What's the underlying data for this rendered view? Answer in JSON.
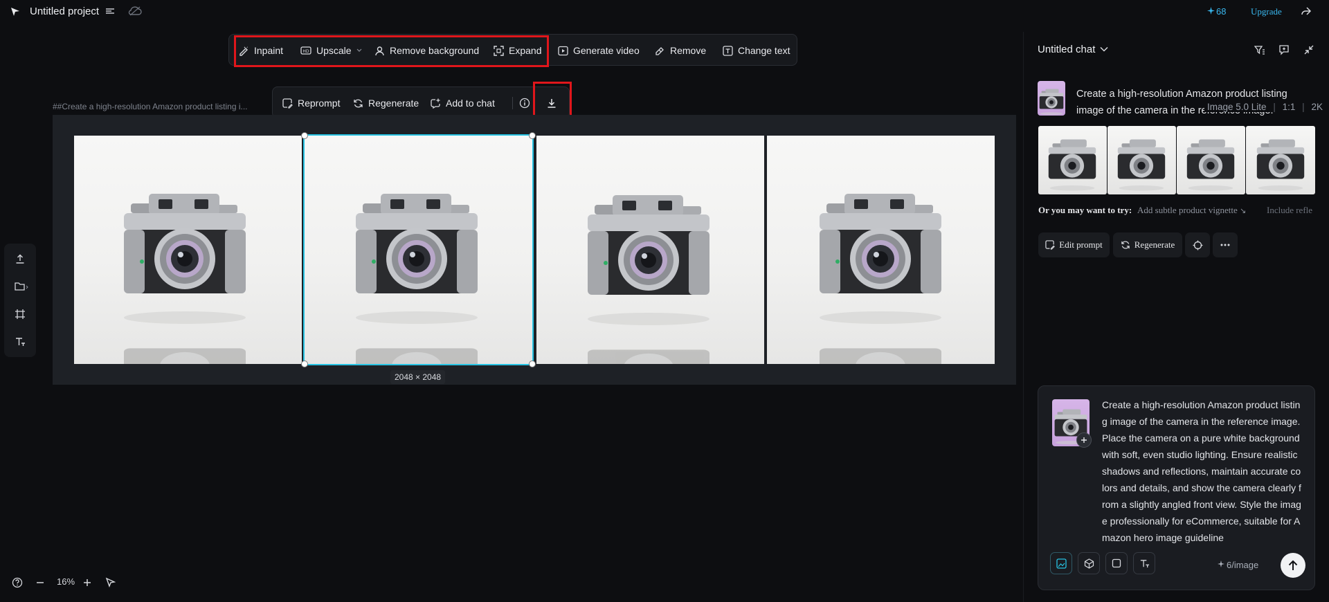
{
  "project": {
    "title": "Untitled project"
  },
  "account": {
    "credits": "68",
    "upgrade_label": "Upgrade"
  },
  "toolbar": {
    "inpaint": "Inpaint",
    "upscale": "Upscale",
    "remove_background": "Remove background",
    "expand": "Expand",
    "generate_video": "Generate video",
    "remove": "Remove",
    "change_text": "Change text"
  },
  "image_toolbar": {
    "reprompt": "Reprompt",
    "regenerate": "Regenerate",
    "add_to_chat": "Add to chat"
  },
  "canvas": {
    "prompt_label": "##Create a high-resolution Amazon product listing i...",
    "selected_dimensions": "2048 × 2048",
    "image_count": 4
  },
  "zoom": {
    "level": "16%"
  },
  "chat": {
    "title": "Untitled chat",
    "message_text": "Create a high-resolution Amazon product listing image of the camera in the reference image.",
    "message_model": "Image 5.0 Lite",
    "message_ratio": "1:1",
    "message_resolution": "2K",
    "suggest_label": "Or you may want to try:",
    "suggestion_1": "Add subtle product vignette",
    "suggestion_2": "Include refle",
    "edit_prompt": "Edit prompt",
    "regenerate": "Regenerate"
  },
  "composer": {
    "text": "Create a high-resolution Amazon product listing image of the camera in the reference image. Place the camera on a pure white background with soft, even studio lighting. Ensure realistic shadows and reflections, maintain accurate colors and details, and show the camera clearly from a slightly angled front view. Style the image professionally for eCommerce, suitable for Amazon hero image guideline",
    "cost": "6/image"
  },
  "colors": {
    "accent": "#27c3e3",
    "highlight": "#e0161b",
    "credits": "#39b8f0",
    "background": "#0d0e11"
  }
}
